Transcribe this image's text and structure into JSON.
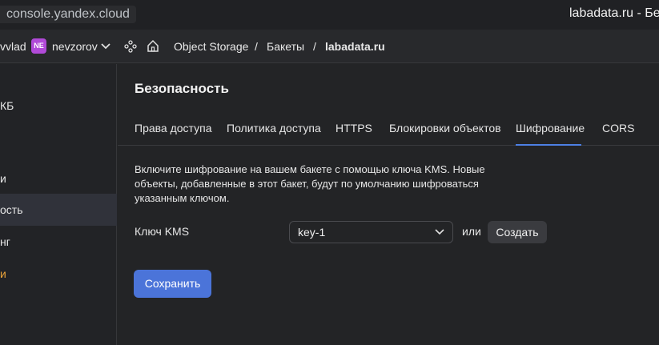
{
  "browser": {
    "url": "console.yandex.cloud",
    "tab_title": "labadata.ru - Бе"
  },
  "topnav": {
    "user": "vvlad",
    "org_badge": "NE",
    "org_name": "nevzorov",
    "breadcrumbs": [
      "Object Storage",
      "Бакеты",
      "labadata.ru"
    ],
    "separator": "/"
  },
  "sidebar": {
    "items": [
      {
        "label": "КБ"
      },
      {
        "label": "и"
      },
      {
        "label": "ость",
        "active": true
      },
      {
        "label": "нг"
      },
      {
        "label": "и"
      }
    ]
  },
  "main": {
    "title": "Безопасность",
    "tabs": [
      {
        "label": "Права доступа"
      },
      {
        "label": "Политика доступа"
      },
      {
        "label": "HTTPS"
      },
      {
        "label": "Блокировки объектов"
      },
      {
        "label": "Шифрование",
        "active": true
      },
      {
        "label": "CORS"
      }
    ],
    "description": "Включите шифрование на вашем бакете с помощью ключа KMS. Новые объекты, добавленные в этот бакет, будут по умолчанию шифроваться указанным ключом.",
    "kms_label": "Ключ KMS",
    "kms_value": "key-1",
    "or_text": "или",
    "create_label": "Создать",
    "save_label": "Сохранить"
  },
  "colors": {
    "accent": "#4b74d9",
    "org_badge": "#b14ad8",
    "active_tab_underline": "#4d80e4",
    "sidebar_last_item": "#e8a23a"
  },
  "icons": [
    "chevron-down-icon",
    "services-icon",
    "home-icon"
  ]
}
